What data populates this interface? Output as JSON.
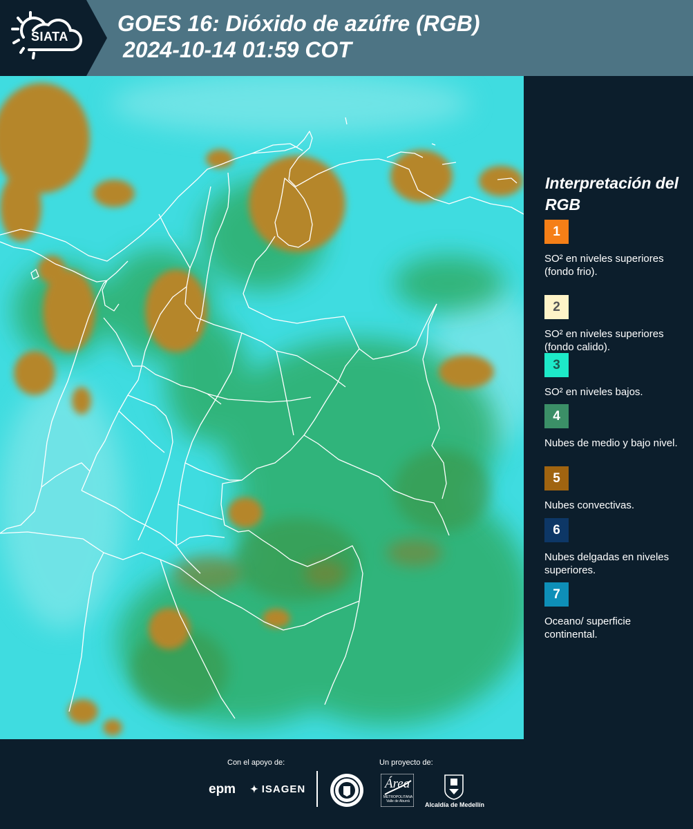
{
  "header": {
    "logo_text": "SIATA",
    "title_line1": "GOES 16: Dióxido de azúfre (RGB)",
    "title_line2": "2024-10-14 01:59 COT"
  },
  "legend": {
    "title": "Interpretación del RGB",
    "items": [
      {
        "number": "1",
        "color": "#f57f17",
        "label": "SO² en niveles superiores (fondo frio)."
      },
      {
        "number": "2",
        "color": "#fff4c8",
        "label": "SO² en niveles superiores (fondo calido)."
      },
      {
        "number": "3",
        "color": "#1de9c8",
        "label": "SO² en niveles bajos."
      },
      {
        "number": "4",
        "color": "#3b8f67",
        "label": "Nubes de medio y bajo nivel."
      },
      {
        "number": "5",
        "color": "#a06410",
        "label": "Nubes convectivas."
      },
      {
        "number": "6",
        "color": "#0d3766",
        "label": "Nubes delgadas en niveles superiores."
      },
      {
        "number": "7",
        "color": "#0e8fb8",
        "label": "Oceano/ superficie continental."
      }
    ]
  },
  "footer": {
    "support_caption": "Con el apoyo de:",
    "project_caption": "Un proyecto de:",
    "sponsor1": "epm",
    "sponsor2": "ISAGEN",
    "area_word": "Área",
    "area_sub": "METROPOLITANA Valle de Aburrá",
    "alcaldia": "Alcaldía de Medellín"
  },
  "colors": {
    "background": "#0c1e2c",
    "header_band": "#4d7484",
    "map_cyan": "#3fdce0",
    "map_green": "#2fae6a",
    "map_orange": "#b5862a",
    "borders": "#ffffff"
  }
}
